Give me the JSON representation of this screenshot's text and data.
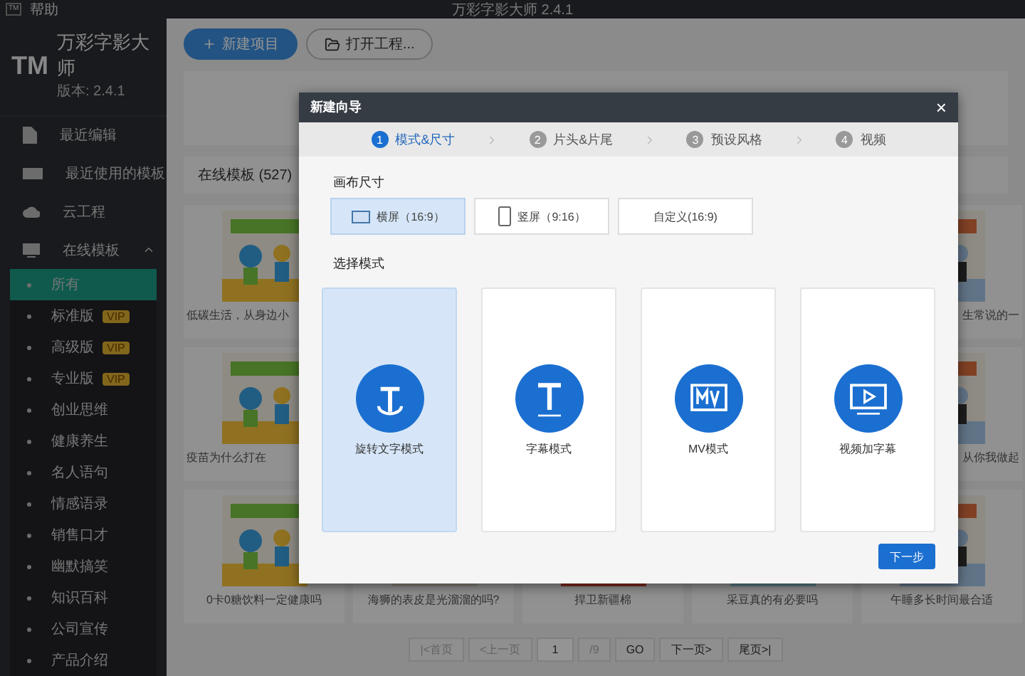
{
  "window": {
    "icon": "TM",
    "title": "万彩字影大师 2.4.1",
    "menu": [
      "帮助"
    ]
  },
  "app": {
    "logo": "TM",
    "name": "万彩字影大师",
    "version": "版本: 2.4.1"
  },
  "sidebar": {
    "items": [
      {
        "label": "最近编辑",
        "selected": false
      },
      {
        "label": "最近使用的模板",
        "selected": false
      },
      {
        "label": "云工程",
        "selected": false
      },
      {
        "label": "在线模板",
        "selected": false,
        "expanded": true,
        "children": [
          {
            "label": "所有",
            "selected": true
          },
          {
            "label": "标准版",
            "badge": "VIP",
            "selected": false
          },
          {
            "label": "高级版",
            "badge": "VIP",
            "selected": false
          },
          {
            "label": "专业版",
            "badge": "VIP",
            "selected": false
          },
          {
            "label": "创业思维",
            "selected": false
          },
          {
            "label": "健康养生",
            "selected": false
          },
          {
            "label": "名人语句",
            "selected": false
          },
          {
            "label": "情感语录",
            "selected": false
          },
          {
            "label": "销售口才",
            "selected": false
          },
          {
            "label": "幽默搞笑",
            "selected": false
          },
          {
            "label": "知识百科",
            "selected": false
          },
          {
            "label": "公司宣传",
            "selected": false
          },
          {
            "label": "产品介绍",
            "selected": false
          }
        ]
      }
    ]
  },
  "toolbar": {
    "buttons": [
      {
        "label": "新建项目",
        "kind": "primary"
      },
      {
        "label": "打开工程...",
        "kind": "folder"
      }
    ]
  },
  "templates": {
    "heading": "在线模板 (527)",
    "rows": [
      [
        {
          "caption": "低碳生活，从身边小"
        },
        null,
        null,
        null,
        {
          "caption": "生常说的一"
        }
      ],
      [
        {
          "caption": "疫苗为什么打在"
        },
        null,
        null,
        null,
        {
          "caption": "从你我做起"
        }
      ],
      [
        {
          "caption": "0卡0糖饮料一定健康吗"
        },
        {
          "caption": "海狮的表皮是光溜溜的吗?"
        },
        {
          "caption": "捍卫新疆棉"
        },
        {
          "caption": "采豆真的有必要吗"
        },
        {
          "caption": "午睡多长时间最合适"
        }
      ]
    ]
  },
  "pagination": {
    "first": "|<首页",
    "prev": "<上一页",
    "page": "1",
    "total": "/9",
    "go": "GO",
    "next": "下一页>",
    "last": "尾页>|"
  },
  "dialog": {
    "title": "新建向导",
    "close": "×",
    "steps": [
      {
        "number": "1",
        "label": "模式&尺寸",
        "selected": true
      },
      {
        "number": "2",
        "label": "片头&片尾",
        "selected": false
      },
      {
        "number": "3",
        "label": "预设风格",
        "selected": false
      },
      {
        "number": "4",
        "label": "视频",
        "selected": false
      }
    ],
    "canvas_heading": "画布尺寸",
    "sizes": [
      {
        "label": "横屏（16:9）",
        "selected": true
      },
      {
        "label": "竖屏（9:16）",
        "selected": false
      },
      {
        "label": "自定义(16:9)",
        "selected": false
      }
    ],
    "mode_heading": "选择模式",
    "modes": [
      {
        "label": "旋转文字模式",
        "selected": true
      },
      {
        "label": "字幕模式",
        "selected": false
      },
      {
        "label": "MV模式",
        "selected": false
      },
      {
        "label": "视频加字幕",
        "selected": false
      }
    ],
    "next": "下一步"
  }
}
